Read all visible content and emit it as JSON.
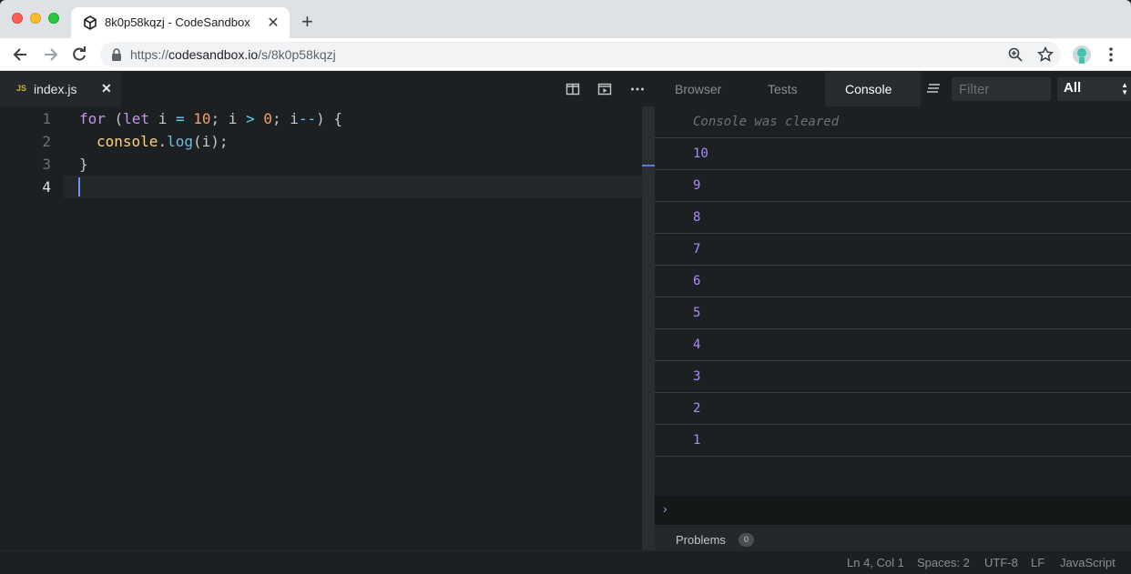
{
  "browser": {
    "tab_title": "8k0p58kqzj - CodeSandbox",
    "tab_close": "✕",
    "new_tab": "+",
    "url_scheme": "https://",
    "url_host": "codesandbox.io",
    "url_path": "/s/8k0p58kqzj"
  },
  "editor": {
    "file_badge": "JS",
    "file_name": "index.js",
    "file_close": "✕",
    "line_numbers": [
      "1",
      "2",
      "3",
      "4"
    ],
    "code": {
      "line1": {
        "kw_for": "for",
        "p1": " (",
        "kw_let": "let",
        "p2": " i ",
        "eq": "=",
        "sp": " ",
        "num10": "10",
        "p3": "; i ",
        "gt": ">",
        "sp2": " ",
        "num0": "0",
        "p4": "; i",
        "dec": "--",
        "p5": ") {"
      },
      "line2": {
        "obj": "console",
        "dot": ".",
        "fn": "log",
        "args": "(i);"
      },
      "line3": "}"
    }
  },
  "panel": {
    "tabs": [
      "Browser",
      "Tests",
      "Console"
    ],
    "active_tab": "Console",
    "filter_placeholder": "Filter",
    "level": "All",
    "console_cleared": "Console was cleared",
    "logs": [
      "10",
      "9",
      "8",
      "7",
      "6",
      "5",
      "4",
      "3",
      "2",
      "1"
    ],
    "prompt": "›",
    "problems_label": "Problems",
    "problems_count": "0"
  },
  "status": {
    "position": "Ln 4, Col 1",
    "spaces": "Spaces: 2",
    "encoding": "UTF-8",
    "eol": "LF",
    "language": "JavaScript"
  },
  "colors": {
    "keyword": "#c792ea",
    "number": "#f29f6b",
    "log_value": "#a98cff",
    "accent": "#6c90ff"
  }
}
